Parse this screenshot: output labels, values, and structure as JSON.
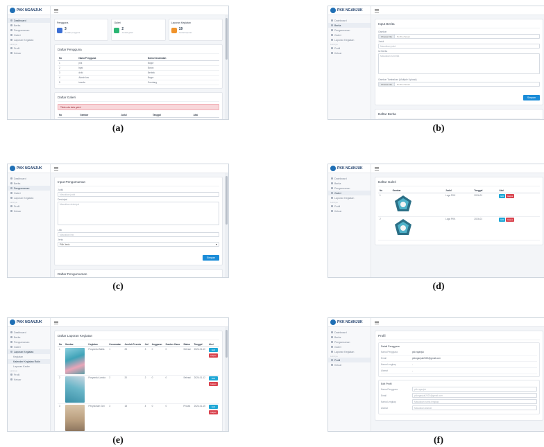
{
  "brand": "PKK NGANJUK",
  "menu": [
    {
      "label": "Dashboard",
      "icon": "dashboard-icon"
    },
    {
      "label": "Berita",
      "icon": "news-icon"
    },
    {
      "label": "Pengumuman",
      "icon": "announcement-icon"
    },
    {
      "label": "Galeri",
      "icon": "gallery-icon"
    },
    {
      "label": "Laporan Kegiatan",
      "icon": "report-icon",
      "chevron": true
    }
  ],
  "menu_lower": [
    {
      "label": "Profil",
      "icon": "user-icon"
    },
    {
      "label": "Keluar",
      "icon": "logout-icon"
    }
  ],
  "menu_section": "Lainnya",
  "menu_report_sub": [
    "Kegiatan",
    "Kalender Kegiatan Rutin",
    "Laporan Kader"
  ],
  "captions": [
    "(a)",
    "(b)",
    "(c)",
    "(d)",
    "(e)",
    "(f)"
  ],
  "colors": {
    "primary": "#1a8cd8",
    "danger": "#d9434e",
    "info": "#1fa7d6",
    "sidebar_active": "#e9edf3"
  },
  "panel_a": {
    "stats": [
      {
        "title": "Pengguna",
        "value": "3",
        "sub": "Jumlah pengguna",
        "color": "#3b6fd4"
      },
      {
        "title": "Galeri",
        "value": "2",
        "sub": "Jumlah galeri",
        "color": "#2bb673"
      },
      {
        "title": "Laporan Kegiatan",
        "value": "19",
        "sub": "Jumlah laporan",
        "color": "#f0932b"
      }
    ],
    "users_title": "Daftar Pengguna",
    "users_headers": [
      "No",
      "Nama Pengguna",
      "Nama Kecamatan"
    ],
    "users_rows": [
      [
        "1",
        "pkk",
        "Bagor"
      ],
      [
        "2",
        "bgst",
        "Baron"
      ],
      [
        "3",
        "dvfd",
        "Berbek"
      ],
      [
        "4",
        "Admin kec",
        "Bagor"
      ],
      [
        "5",
        "inseda",
        "Gondang"
      ]
    ],
    "gallery_title": "Daftar Galeri",
    "gallery_alert": "Tidak ada data galeri",
    "gallery_headers": [
      "No",
      "Gambar",
      "Judul",
      "Tanggal",
      "Aksi"
    ]
  },
  "panel_b": {
    "form_title": "Input Berita",
    "label_image": "Gambar",
    "file_btn": "Choose File",
    "file_none": "No file chosen",
    "label_title": "Judul",
    "title_ph": "Masukkan judul",
    "label_content": "Isi Berita",
    "content_ph": "Masukkan isi berita",
    "label_extra": "Gambar Tambahan (Multiple Upload)",
    "submit": "Simpan",
    "list_title": "Daftar Berita"
  },
  "panel_c": {
    "form_title": "Input Pengumuman",
    "label_title": "Judul",
    "title_ph": "Masukkan judul",
    "label_desc": "Deskripsi",
    "desc_ph": "Masukkan deskripsi",
    "label_link": "Link",
    "link_ph": "Masukkan link",
    "label_type": "Jenis",
    "type_value": "Pilih Jenis",
    "submit": "Simpan",
    "list_title": "Daftar Pengumuman"
  },
  "panel_d": {
    "title": "Daftar Galeri",
    "headers": [
      "No",
      "Gambar",
      "Judul",
      "Tanggal",
      "Aksi"
    ],
    "rows": [
      {
        "no": "1",
        "judul": "Logo PKK",
        "tanggal": "2024-01",
        "edit": "Edit",
        "hapus": "Hapus"
      },
      {
        "no": "2",
        "judul": "Logo PKK",
        "tanggal": "2024-01",
        "edit": "Edit",
        "hapus": "Hapus"
      }
    ]
  },
  "panel_e": {
    "title": "Daftar Laporan Kegiatan",
    "headers": [
      "No",
      "Gambar",
      "Kegiatan",
      "Kecamatan",
      "Jumlah Peserta",
      "Jml",
      "Anggaran",
      "Sumber Dana",
      "Status",
      "Tanggal",
      "Aksi"
    ],
    "rows": [
      {
        "no": "1",
        "kegiatan": "Posyandu Balita",
        "kec": "1",
        "peserta": "25",
        "jml": "3",
        "angg": "0",
        "dana": "0",
        "status": "Selesai",
        "tgl": "2024-01-10",
        "edit": "Edit",
        "hapus": "Hapus"
      },
      {
        "no": "2",
        "kegiatan": "Posyandu Lansia",
        "kec": "2",
        "peserta": "20",
        "jml": "2",
        "angg": "0",
        "dana": "0",
        "status": "Selesai",
        "tgl": "2024-01-12",
        "edit": "Edit",
        "hapus": "Hapus"
      },
      {
        "no": "3",
        "kegiatan": "Penyuluhan Gizi",
        "kec": "3",
        "peserta": "18",
        "jml": "4",
        "angg": "0",
        "dana": "0",
        "status": "Proses",
        "tgl": "2024-01-15",
        "edit": "Edit",
        "hapus": "Hapus"
      }
    ]
  },
  "panel_f": {
    "title": "Profil",
    "info_title": "Detail Pengguna",
    "info": [
      {
        "k": "Nama Pengguna",
        "v": "pkk nganjuk"
      },
      {
        "k": "Email",
        "v": "pkknganjuk2023@gmail.com"
      },
      {
        "k": "Nama Lengkap",
        "v": "-"
      },
      {
        "k": "Alamat",
        "v": "-"
      }
    ],
    "edit_title": "Edit Profil",
    "edit_fields": [
      {
        "k": "Nama Pengguna",
        "v": "pkk nganjuk"
      },
      {
        "k": "Email",
        "v": "pkknganjuk2023@gmail.com"
      },
      {
        "k": "Nama Lengkap",
        "v": "Masukkan nama lengkap"
      },
      {
        "k": "Alamat",
        "v": "Masukkan alamat"
      }
    ]
  }
}
